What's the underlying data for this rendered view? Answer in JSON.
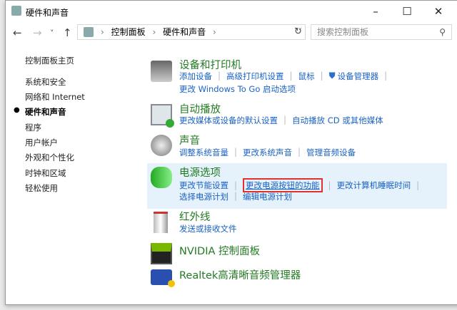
{
  "window": {
    "title": "硬件和声音",
    "minimize": "–",
    "maximize": "☐",
    "close": "✕"
  },
  "nav": {
    "back": "←",
    "forward": "→",
    "dropdown": "˅",
    "up": "↑",
    "refresh": "↻",
    "addr_dropdown": "˅"
  },
  "breadcrumb": [
    "控制面板",
    "硬件和声音"
  ],
  "breadcrumb_sep": "›",
  "search": {
    "placeholder": "搜索控制面板",
    "icon": "⚲"
  },
  "sidebar": {
    "items": [
      {
        "label": "控制面板主页"
      },
      {
        "label": "系统和安全"
      },
      {
        "label": "网络和 Internet"
      },
      {
        "label": "硬件和声音",
        "active": true
      },
      {
        "label": "程序"
      },
      {
        "label": "用户帐户"
      },
      {
        "label": "外观和个性化"
      },
      {
        "label": "时钟和区域"
      },
      {
        "label": "轻松使用"
      }
    ]
  },
  "sections": [
    {
      "title": "设备和打印机",
      "links": [
        [
          "添加设备",
          "高级打印机设置",
          "鼠标",
          "设备管理器"
        ],
        [
          "更改 Windows To Go 启动选项"
        ]
      ]
    },
    {
      "title": "自动播放",
      "links": [
        [
          "更改媒体或设备的默认设置",
          "自动播放 CD 或其他媒体"
        ]
      ]
    },
    {
      "title": "声音",
      "links": [
        [
          "调整系统音量",
          "更改系统声音",
          "管理音频设备"
        ]
      ]
    },
    {
      "title": "电源选项",
      "links": [
        [
          "更改节能设置",
          "更改电源按钮的功能",
          "更改计算机睡眠时间"
        ],
        [
          "选择电源计划",
          "编辑电源计划"
        ]
      ]
    },
    {
      "title": "红外线",
      "links": [
        [
          "发送或接收文件"
        ]
      ]
    },
    {
      "title": "NVIDIA 控制面板",
      "links": []
    },
    {
      "title": "Realtek高清晰音频管理器",
      "links": []
    }
  ],
  "colors": {
    "heading": "#237b23",
    "link": "#1a62c4",
    "highlight": "#e5f1fb",
    "callout": "#e03030"
  }
}
